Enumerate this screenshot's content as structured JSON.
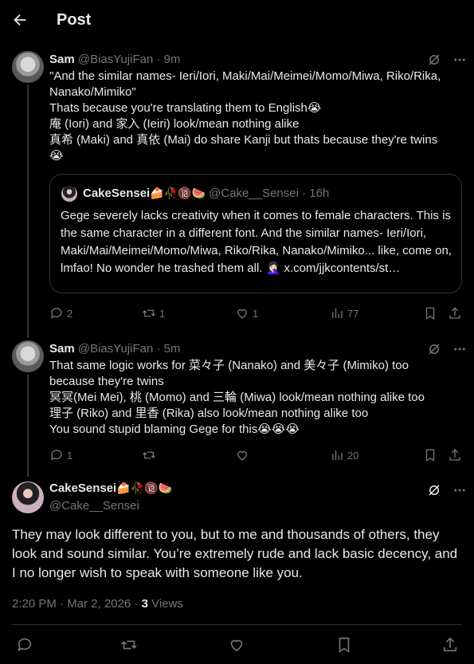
{
  "header": {
    "title": "Post"
  },
  "reply1": {
    "name": "Sam",
    "handle": "@BiasYujiFan",
    "time": "9m",
    "text": "\"And the similar names- Ieri/Iori, Maki/Mai/Meimei/Momo/Miwa, Riko/Rika,\nNanako/Mimiko\"\nThats because you're translating them to English😭\n庵 (Iori) and 家入 (Ieiri) look/mean nothing alike\n真希 (Maki) and 真依 (Mai) do share Kanji but thats because they're twins\n😭",
    "quote": {
      "name": "CakeSensei",
      "name_emojis": "🍰🥀🔞🍉",
      "handle": "@Cake__Sensei",
      "time": "16h",
      "text": "Gege severely lacks creativity when it comes to female characters. This is the same character in a different font. And the similar names- Ieri/Iori, Maki/Mai/Meimei/Momo/Miwa, Riko/Rika, Nanako/Mimiko... like, come on, lmfao! No wonder he trashed them all. 🤦🏻‍♀️ x.com/jjkcontents/st…"
    },
    "replies": "2",
    "reposts": "1",
    "likes": "1",
    "views": "77"
  },
  "reply2": {
    "name": "Sam",
    "handle": "@BiasYujiFan",
    "time": "5m",
    "text": "That same logic works for 菜々子 (Nanako) and 美々子 (Mimiko) too\nbecause they're twins\n冥冥(Mei Mei), 桃 (Momo) and 三輪 (Miwa) look/mean nothing alike too\n理子 (Riko) and 里香 (Rika) also look/mean nothing alike too\nYou sound stupid blaming Gege for this😭😭😭",
    "replies": "1",
    "reposts": "",
    "likes": "",
    "views": "20"
  },
  "main": {
    "name": "CakeSensei",
    "name_emojis": "🍰🥀🔞🍉",
    "handle": "@Cake__Sensei",
    "text": "They may look different to you, but to me and thousands of others, they look and sound similar. You’re extremely rude and lack basic decency, and I no longer wish to speak with someone like you.",
    "timestamp": "2:20 PM · Mar 2, 2026 · ",
    "views_count": "3",
    "views_label": " Views"
  },
  "colors": {
    "background": "#000000",
    "text": "#e7e9ea",
    "muted": "#71767b",
    "border": "#2f3336"
  },
  "icons": [
    "back-arrow-icon",
    "grok-icon",
    "more-icon",
    "reply-icon",
    "repost-icon",
    "like-icon",
    "views-icon",
    "bookmark-icon",
    "share-icon"
  ]
}
